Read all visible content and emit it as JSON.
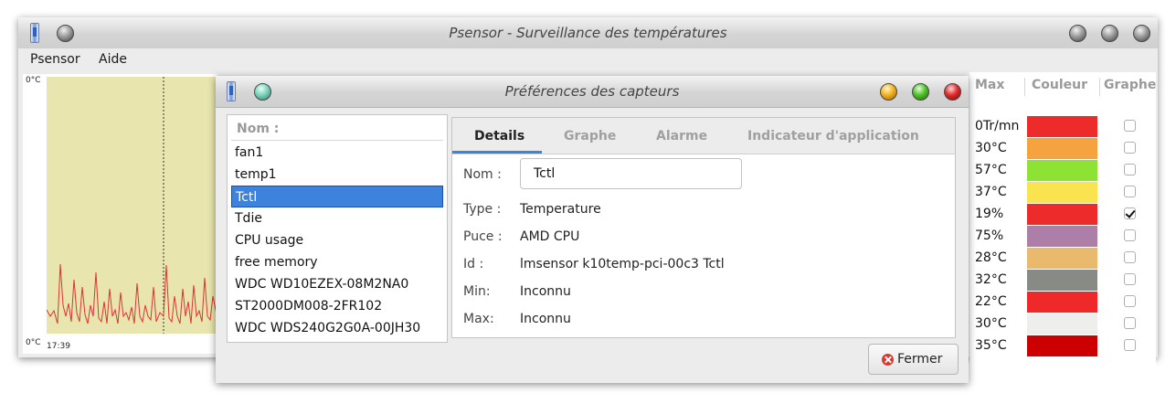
{
  "main_window": {
    "title": "Psensor - Surveillance des températures",
    "menu": [
      "Psensor",
      "Aide"
    ],
    "graph": {
      "y_top_label": "0°C",
      "y_bottom_label": "0°C",
      "x_label": "17:39"
    },
    "sensor_table": {
      "headers": {
        "max": "Max",
        "color": "Couleur",
        "graph": "Graphe"
      },
      "rows": [
        {
          "max": "0Tr/mn",
          "color": "#ee2b2b",
          "graph": false
        },
        {
          "max": "30°C",
          "color": "#f5a33f",
          "graph": false
        },
        {
          "max": "57°C",
          "color": "#8ee233",
          "graph": false
        },
        {
          "max": "37°C",
          "color": "#f9e450",
          "graph": false
        },
        {
          "max": "19%",
          "color": "#ee2b2b",
          "graph": true
        },
        {
          "max": "75%",
          "color": "#ad7fa8",
          "graph": false
        },
        {
          "max": "28°C",
          "color": "#e9b96e",
          "graph": false
        },
        {
          "max": "32°C",
          "color": "#888a85",
          "graph": false
        },
        {
          "max": "22°C",
          "color": "#ef2929",
          "graph": false
        },
        {
          "max": "30°C",
          "color": "#eeeeec",
          "graph": false
        },
        {
          "max": "35°C",
          "color": "#cc0000",
          "graph": false
        }
      ]
    }
  },
  "dialog": {
    "title": "Préférences des capteurs",
    "list_header": "Nom :",
    "sensors": [
      "fan1",
      "temp1",
      "Tctl",
      "Tdie",
      "CPU usage",
      "free memory",
      "WDC WD10EZEX-08M2NA0",
      "ST2000DM008-2FR102",
      "WDC WDS240G2G0A-00JH30"
    ],
    "selected_sensor": "Tctl",
    "tabs": [
      "Details",
      "Graphe",
      "Alarme",
      "Indicateur d'application"
    ],
    "active_tab": "Details",
    "details": {
      "name_label": "Nom :",
      "name_value": "Tctl",
      "type_label": "Type :",
      "type_value": "Temperature",
      "chip_label": "Puce :",
      "chip_value": "AMD CPU",
      "id_label": "Id :",
      "id_value": "lmsensor k10temp-pci-00c3 Tctl",
      "min_label": "Min:",
      "min_value": "Inconnu",
      "max_label": "Max:",
      "max_value": "Inconnu"
    },
    "close_button": "Fermer"
  }
}
